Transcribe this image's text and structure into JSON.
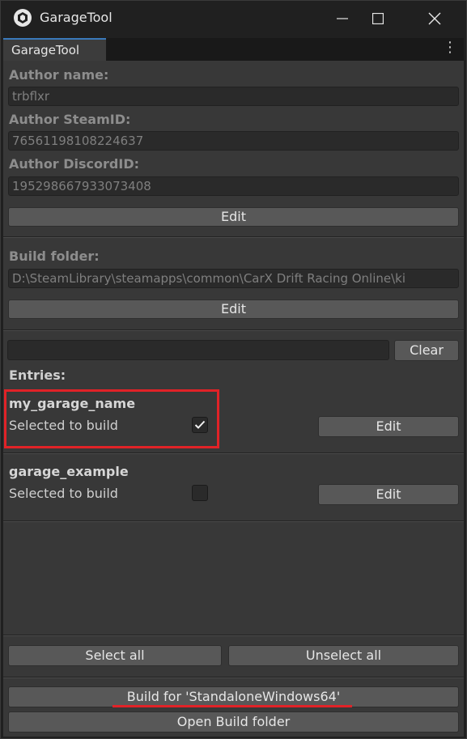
{
  "window": {
    "title": "GarageTool",
    "icons": {
      "app": "unity-logo-icon",
      "minimize": "minimize-icon",
      "maximize": "maximize-icon",
      "close": "close-icon"
    }
  },
  "tab": {
    "label": "GarageTool",
    "menu_icon": "more-vertical-icon"
  },
  "author": {
    "name_label": "Author name:",
    "name_value": "trbflxr",
    "steam_label": "Author SteamID:",
    "steam_value": "76561198108224637",
    "discord_label": "Author DiscordID:",
    "discord_value": "195298667933073408",
    "edit_label": "Edit"
  },
  "build_folder": {
    "label": "Build folder:",
    "path": "D:\\SteamLibrary\\steamapps\\common\\CarX Drift Racing Online\\ki",
    "edit_label": "Edit"
  },
  "search": {
    "value": "",
    "clear_label": "Clear"
  },
  "entries_label": "Entries:",
  "entries": [
    {
      "name": "my_garage_name",
      "status_label": "Selected to build",
      "selected": true,
      "edit_label": "Edit"
    },
    {
      "name": "garage_example",
      "status_label": "Selected to build",
      "selected": false,
      "edit_label": "Edit"
    }
  ],
  "actions": {
    "select_all": "Select all",
    "unselect_all": "Unselect all",
    "build": "Build for 'StandaloneWindows64'",
    "open_folder": "Open Build folder"
  },
  "colors": {
    "annotation": "#e12227",
    "tab_accent": "#3a79bb"
  }
}
